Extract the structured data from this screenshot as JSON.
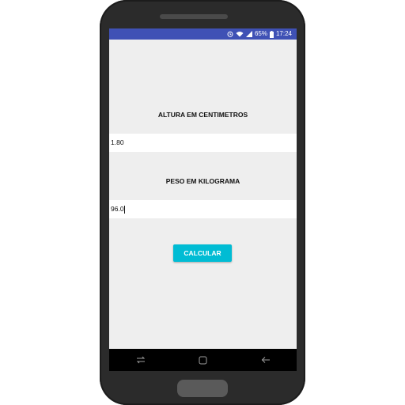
{
  "status_bar": {
    "battery_percent": "65%",
    "time": "17:24",
    "icons": [
      "alarm-icon",
      "wifi-icon",
      "signal-icon",
      "battery-icon"
    ]
  },
  "form": {
    "height_label": "ALTURA EM CENTIMETROS",
    "height_value": "1.80",
    "weight_label": "PESO EM KILOGRAMA",
    "weight_value": "96.0",
    "calculate_button": "CALCULAR"
  },
  "nav_bar": {
    "icons": [
      "recent-apps-icon",
      "home-icon",
      "back-icon"
    ]
  },
  "colors": {
    "status_bar": "#3f51b5",
    "button": "#00bcd4",
    "background": "#eeeeee"
  }
}
